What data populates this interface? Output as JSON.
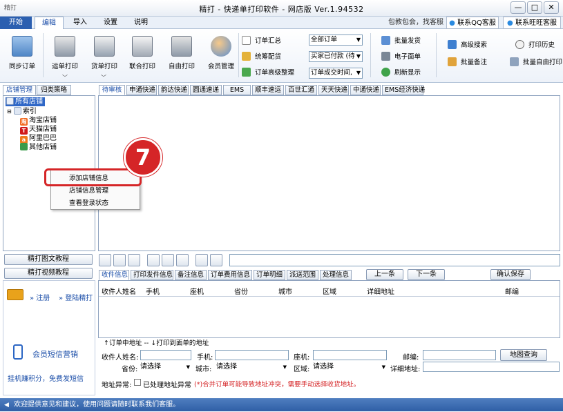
{
  "window": {
    "title": "精打 - 快递单打印软件 - 网店版 Ver.1.94532",
    "logo": "精打"
  },
  "menu": [
    {
      "label": "开始",
      "active": false,
      "start": true
    },
    {
      "label": "编辑",
      "active": true
    },
    {
      "label": "导入"
    },
    {
      "label": "设置"
    },
    {
      "label": "说明"
    }
  ],
  "menu_right": {
    "promo": "包教包会，找客服",
    "qq": "联系QQ客服",
    "wangwang": "联系旺旺客服"
  },
  "ribbon": {
    "big": [
      "同步订单",
      "运单打印",
      "货单打印",
      "联合打印",
      "自由打印",
      "会员管理"
    ],
    "group1": [
      "订单汇总",
      "统筹配货",
      "订单高级整理"
    ],
    "combos": [
      "全部订单",
      "买家已付款 (待",
      "订单成交时间,"
    ],
    "group2": [
      "批量发货",
      "电子面单",
      "刷新显示"
    ],
    "group3": [
      "高级搜索",
      "批量备注"
    ],
    "group4": [
      "打印历史",
      "批量自由打印"
    ]
  },
  "left": {
    "tabs": [
      "店铺管理",
      "归类策略"
    ],
    "tree": {
      "root": "所有店铺",
      "index": "索引",
      "shops": [
        "淘宝店铺",
        "天猫店铺",
        "阿里巴巴",
        "其他店铺"
      ]
    },
    "shop_icons": [
      "淘",
      "T",
      "a",
      ""
    ],
    "btn_text_tutorial": "精打图文教程",
    "btn_video_tutorial": "精打视频教程",
    "register": "注册",
    "login": "登陆精打",
    "sms": "会员短信营销",
    "earn": "挂机赚积分，免费发短信"
  },
  "context_menu": [
    "添加店铺信息",
    "店铺信息管理",
    "查看登录状态"
  ],
  "callout": "7",
  "order_tabs": [
    "待审核",
    "申通快递",
    "韵达快递",
    "圆通速递",
    "EMS",
    "顺丰速运",
    "百世汇通",
    "天天快递",
    "中通快递",
    "EMS经济快递"
  ],
  "detail": {
    "tabs": [
      "收件信息",
      "打印发件信息",
      "备注信息",
      "订单费用信息",
      "订单明细",
      "派送范围",
      "处理信息"
    ],
    "prev": "上一条",
    "next": "下一条",
    "confirm": "确认保存",
    "columns": [
      "收件人姓名",
      "手机",
      "座机",
      "省份",
      "城市",
      "区域",
      "详细地址",
      "邮编"
    ],
    "address_note": "↑订单中地址  --  ↓打印到面单的地址",
    "form": {
      "name": "收件人姓名:",
      "mobile": "手机:",
      "phone": "座机:",
      "zip": "邮编:",
      "map": "地图查询",
      "province": "省份:",
      "city": "城市:",
      "district": "区域:",
      "address": "详细地址:",
      "select": "请选择"
    },
    "abnormal": "地址异常:",
    "processed": "已处理地址异常",
    "warning": "(*)合并订单可能导致地址冲突，需要手动选择收货地址。"
  },
  "status": "欢迎提供意见和建议，使用问题请随时联系我们客服。",
  "colors": {
    "accent": "#1a4da8",
    "highlight": "#d52527",
    "status": "#3566ad"
  }
}
